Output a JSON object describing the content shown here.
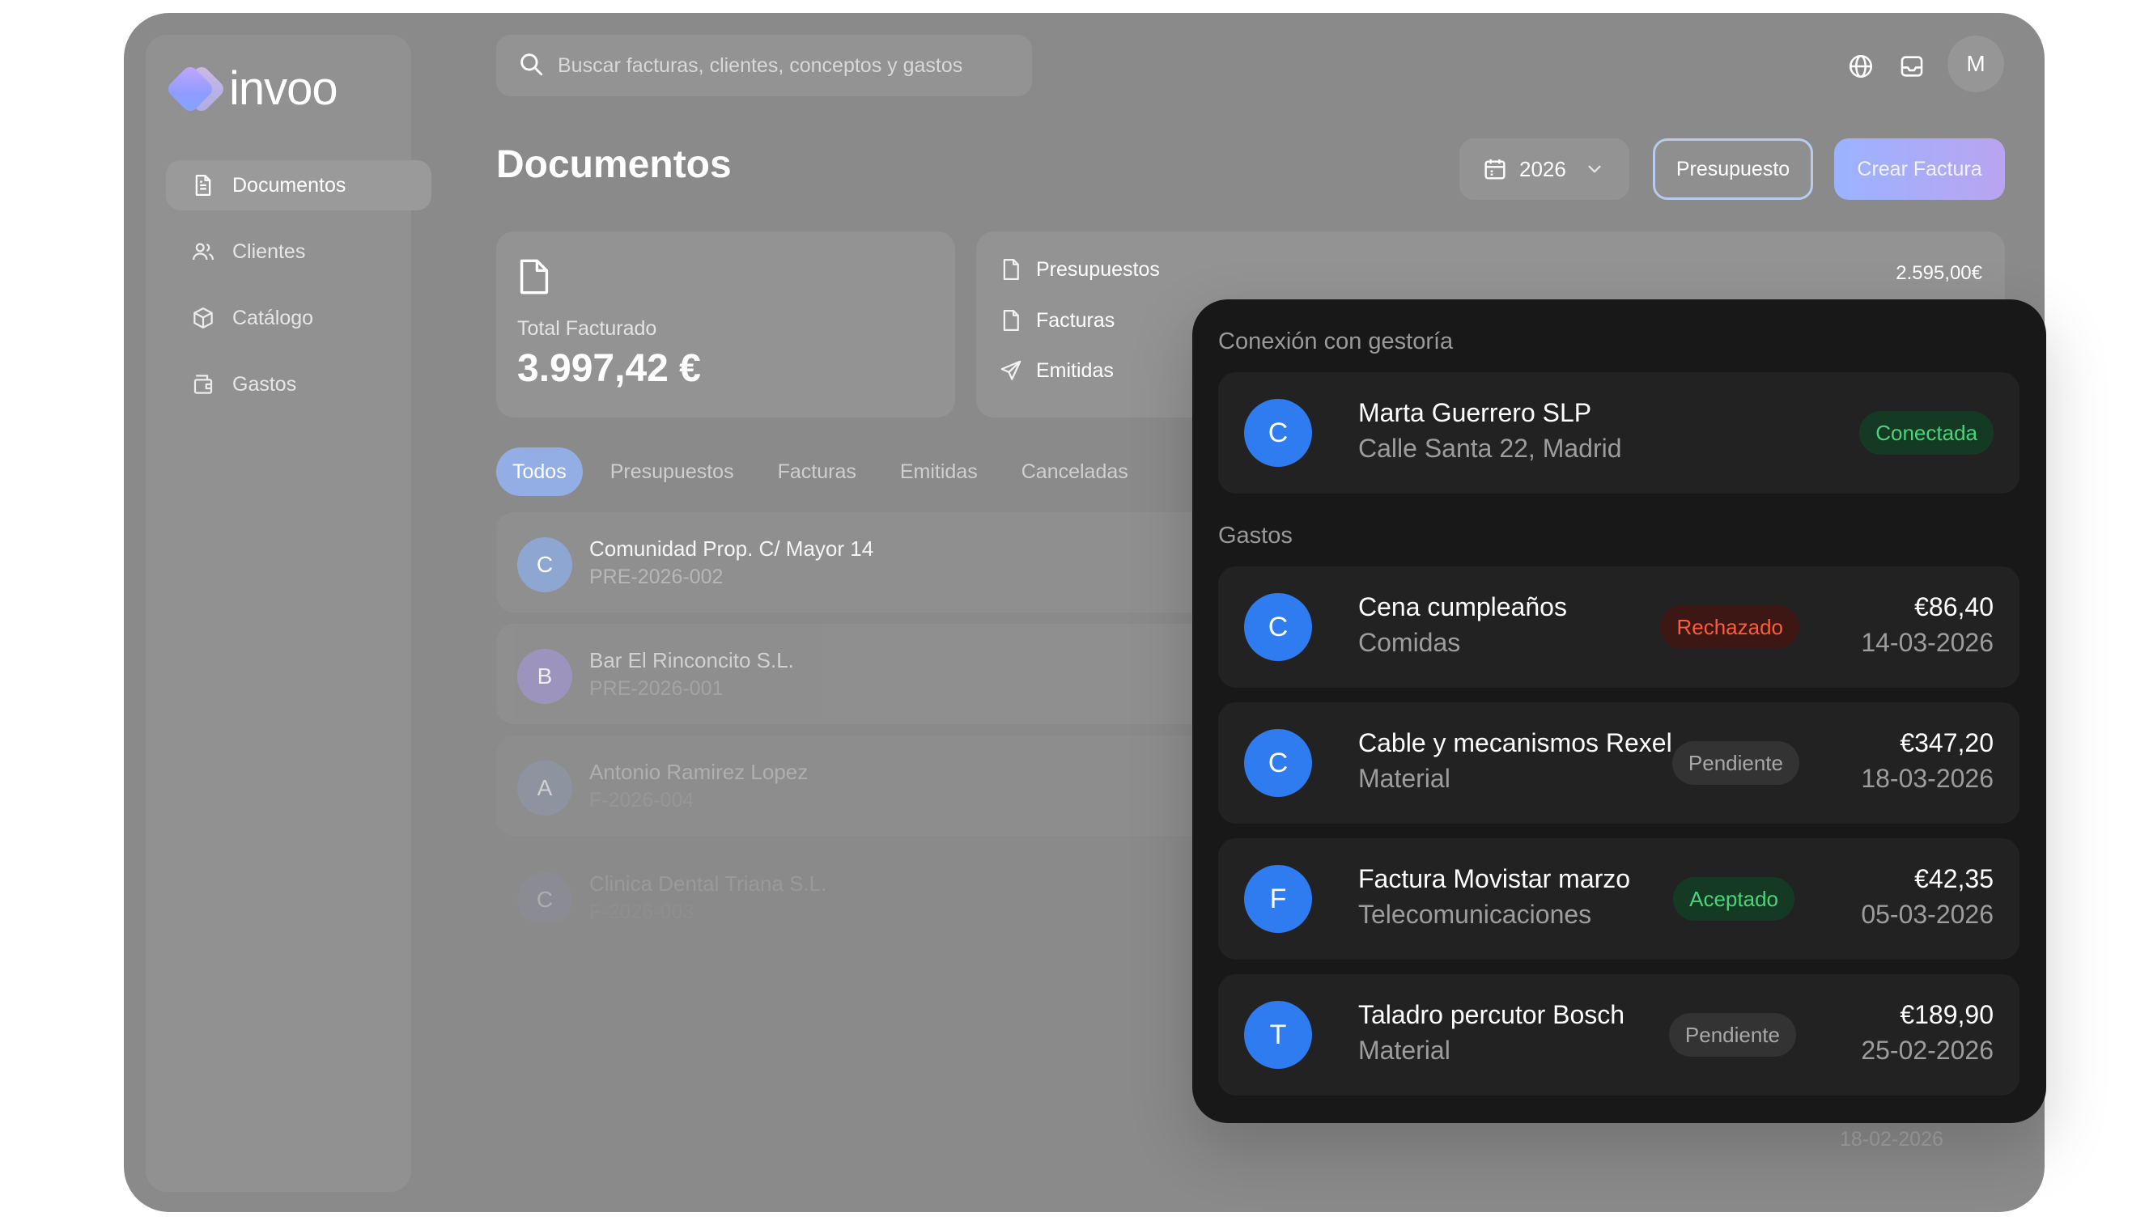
{
  "app": {
    "logo_text": "invoo",
    "brand_gradient": [
      "#c6a6ff",
      "#7fa6ff"
    ]
  },
  "sidebar": {
    "items": [
      {
        "label": "Documentos",
        "icon": "document-icon",
        "active": true
      },
      {
        "label": "Clientes",
        "icon": "users-icon",
        "active": false
      },
      {
        "label": "Catálogo",
        "icon": "box-icon",
        "active": false
      },
      {
        "label": "Gastos",
        "icon": "wallet-icon",
        "active": false
      }
    ]
  },
  "search": {
    "placeholder": "Buscar facturas, clientes, conceptos y gastos"
  },
  "header": {
    "icons": [
      "globe-icon",
      "inbox-icon"
    ],
    "avatar_initial": "M",
    "title": "Documentos",
    "year": "2026",
    "presupuesto_label": "Presupuesto",
    "crear_label": "Crear Factura"
  },
  "summary": {
    "total_label": "Total Facturado",
    "total_value": "3.997,42 €",
    "stats": [
      {
        "label": "Presupuestos",
        "icon": "file-icon"
      },
      {
        "label": "Facturas",
        "icon": "file-icon"
      },
      {
        "label": "Emitidas",
        "icon": "send-icon"
      }
    ],
    "presupuestos_amount": "2.595,00€"
  },
  "tabs": [
    "Todos",
    "Presupuestos",
    "Facturas",
    "Emitidas",
    "Canceladas"
  ],
  "documents": [
    {
      "initial": "C",
      "name": "Comunidad Prop. C/ Mayor 14",
      "ref": "PRE-2026-002",
      "color": "#8ea6d2"
    },
    {
      "initial": "B",
      "name": "Bar El Rinconcito S.L.",
      "ref": "PRE-2026-001",
      "color": "#a096c6"
    },
    {
      "initial": "A",
      "name": "Antonio Ramirez Lopez",
      "ref": "F-2026-004",
      "color": "#9299b0"
    },
    {
      "initial": "C",
      "name": "Clinica Dental Triana S.L.",
      "ref": "F-2026-003",
      "color": "#8d90a8"
    }
  ],
  "faded_date": "18-02-2026",
  "panel": {
    "gestoria_title": "Conexión con gestoría",
    "gestoria": {
      "initial": "C",
      "name": "Marta Guerrero SLP",
      "address": "Calle Santa 22, Madrid",
      "status": "Conectada"
    },
    "gastos_title": "Gastos",
    "gastos": [
      {
        "initial": "C",
        "title": "Cena cumpleaños",
        "category": "Comidas",
        "status": "Rechazado",
        "status_color": "red",
        "amount": "€86,40",
        "date": "14-03-2026"
      },
      {
        "initial": "C",
        "title": "Cable y mecanismos Rexel",
        "category": "Material",
        "status": "Pendiente",
        "status_color": "grey",
        "amount": "€347,20",
        "date": "18-03-2026"
      },
      {
        "initial": "F",
        "title": "Factura Movistar marzo",
        "category": "Telecomunicaciones",
        "status": "Aceptado",
        "status_color": "green",
        "amount": "€42,35",
        "date": "05-03-2026"
      },
      {
        "initial": "T",
        "title": "Taladro percutor Bosch",
        "category": "Material",
        "status": "Pendiente",
        "status_color": "grey",
        "amount": "€189,90",
        "date": "25-02-2026"
      }
    ]
  }
}
